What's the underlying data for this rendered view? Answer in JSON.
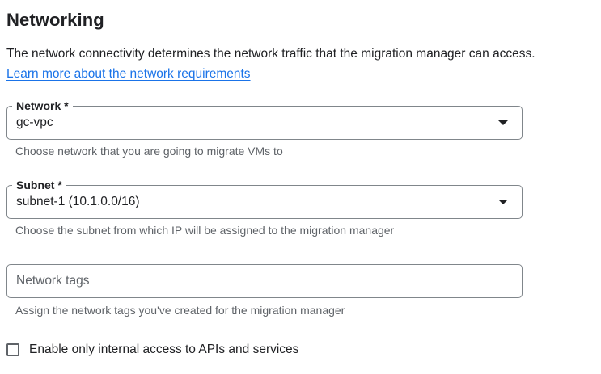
{
  "section": {
    "title": "Networking",
    "description": "The network connectivity determines the network traffic that the migration manager can access.",
    "learn_more_link": "Learn more about the network requirements"
  },
  "network_field": {
    "label": "Network *",
    "value": "gc-vpc",
    "hint": "Choose network that you are going to migrate VMs to"
  },
  "subnet_field": {
    "label": "Subnet *",
    "value": "subnet-1 (10.1.0.0/16)",
    "hint": "Choose the subnet from which IP will be assigned to the migration manager"
  },
  "network_tags_field": {
    "placeholder": "Network tags",
    "value": "",
    "hint": "Assign the network tags you've created for the migration manager"
  },
  "internal_access_checkbox": {
    "label": "Enable only internal access to APIs and services",
    "checked": false
  },
  "icons": {
    "dropdown": "triangle-down-icon"
  },
  "colors": {
    "link": "#1a73e8",
    "border": "#80868b",
    "text": "#202124",
    "hint_text": "#5f6368"
  }
}
